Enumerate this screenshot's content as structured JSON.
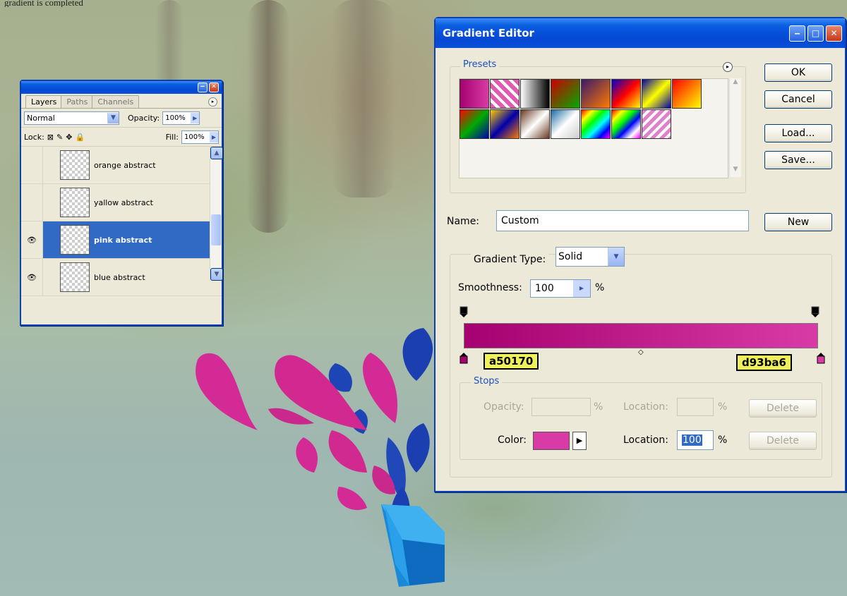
{
  "caption": "gradient is completed",
  "layers_panel": {
    "tabs": [
      "Layers",
      "Paths",
      "Channels"
    ],
    "blend_mode": "Normal",
    "opacity_label": "Opacity:",
    "opacity_value": "100%",
    "lock_label": "Lock:",
    "fill_label": "Fill:",
    "fill_value": "100%",
    "layers": [
      {
        "name": "orange abstract",
        "visible": false,
        "selected": false
      },
      {
        "name": "yallow abstract",
        "visible": false,
        "selected": false
      },
      {
        "name": "pink abstract",
        "visible": true,
        "selected": true
      },
      {
        "name": "blue abstract",
        "visible": true,
        "selected": false
      }
    ],
    "tool_icons": [
      "link-icon",
      "layer-style-icon",
      "mask-icon",
      "adjustment-icon",
      "folder-icon",
      "new-layer-icon",
      "trash-icon"
    ],
    "tool_glyphs": [
      "⚭",
      "ⓕ",
      "◘",
      "◐",
      "▭",
      "▣",
      "🗑"
    ]
  },
  "gradient_editor": {
    "title": "Gradient Editor",
    "presets_label": "Presets",
    "buttons": {
      "ok": "OK",
      "cancel": "Cancel",
      "load": "Load...",
      "save": "Save...",
      "new": "New"
    },
    "name_label": "Name:",
    "name_value": "Custom",
    "gradient_type_label": "Gradient Type:",
    "gradient_type_value": "Solid",
    "smoothness_label": "Smoothness:",
    "smoothness_value": "100",
    "percent": "%",
    "start_color": "#a50170",
    "end_color": "#d93ba6",
    "start_hex": "a50170",
    "end_hex": "d93ba6",
    "stops_label": "Stops",
    "opacity_label": "Opacity:",
    "location_label": "Location:",
    "delete_label": "Delete",
    "color_label": "Color:",
    "color_location_value": "100",
    "accent_color": "#0a4fd6"
  }
}
